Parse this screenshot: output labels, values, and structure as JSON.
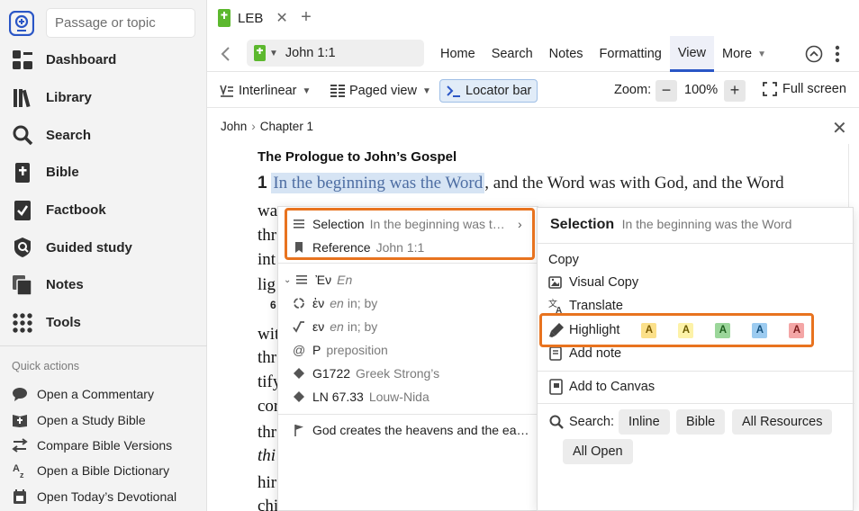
{
  "sidebar": {
    "search_placeholder": "Passage or topic",
    "nav": [
      {
        "label": "Dashboard",
        "icon": "dashboard-icon"
      },
      {
        "label": "Library",
        "icon": "library-icon"
      },
      {
        "label": "Search",
        "icon": "search-icon"
      },
      {
        "label": "Bible",
        "icon": "bible-icon"
      },
      {
        "label": "Factbook",
        "icon": "factbook-icon"
      },
      {
        "label": "Guided study",
        "icon": "guided-study-icon"
      },
      {
        "label": "Notes",
        "icon": "notes-icon"
      },
      {
        "label": "Tools",
        "icon": "tools-icon"
      }
    ],
    "quick_actions_title": "Quick actions",
    "quick_actions": [
      {
        "label": "Open a Commentary",
        "icon": "commentary-icon"
      },
      {
        "label": "Open a Study Bible",
        "icon": "study-bible-icon"
      },
      {
        "label": "Compare Bible Versions",
        "icon": "compare-icon"
      },
      {
        "label": "Open a Bible Dictionary",
        "icon": "dictionary-icon"
      },
      {
        "label": "Open Today’s Devotional",
        "icon": "devotional-icon"
      }
    ]
  },
  "tab": {
    "label": "LEB",
    "close": "✕",
    "new": "+"
  },
  "toolbar": {
    "reference": "John 1:1",
    "menu": [
      "Home",
      "Search",
      "Notes",
      "Formatting",
      "View",
      "More"
    ],
    "active_menu": "View"
  },
  "viewbar": {
    "interlinear": "Interlinear",
    "paged_view": "Paged view",
    "locator_bar": "Locator bar",
    "zoom_label": "Zoom:",
    "zoom_minus": "−",
    "zoom_value": "100%",
    "zoom_plus": "+",
    "full_screen": "Full screen"
  },
  "breadcrumb": {
    "book": "John",
    "sep": "›",
    "chapter": "Chapter 1",
    "close": "✕"
  },
  "reader": {
    "heading": "The Prologue to John’s Gospel",
    "verse_num": "1",
    "highlighted": "In the beginning was the Word",
    "rest": ", and the Word was with God, and the Word",
    "frag_wa": "wa",
    "frag_thr": "thr",
    "frag_int": "int",
    "frag_lig": "lig",
    "frag_6": "6",
    "frag_wit": "wit",
    "frag_thr2": "thr",
    "frag_tify": "tify",
    "frag_cor": "cor",
    "frag_thr3": "thr",
    "frag_thi": "thi",
    "frag_hir": "hir",
    "frag_chi": "chi"
  },
  "context_menu": {
    "selection_label": "Selection",
    "selection_value": "In the beginning was t…",
    "reference_label": "Reference",
    "reference_value": "John 1:1",
    "greek_word": "Ἐν",
    "greek_translit": "En",
    "lemma": "ἐν",
    "lemma_gloss_translit": "en",
    "lemma_gloss": "in; by",
    "root": "εν",
    "root_translit": "en",
    "root_gloss": "in; by",
    "morph": "P",
    "morph_desc": "preposition",
    "strongs": "G1722",
    "strongs_desc": "Greek Strong’s",
    "ln": "LN 67.33",
    "ln_desc": "Louw-Nida",
    "topic": "God creates the heavens and the ea…"
  },
  "panel": {
    "title": "Selection",
    "subtitle": "In the beginning was the Word",
    "copy": "Copy",
    "visual_copy": "Visual Copy",
    "translate": "Translate",
    "highlight": "Highlight",
    "swatch_letter": "A",
    "swatch_colors": [
      "#f6d55c",
      "#f8e27a",
      "#4caf50",
      "#4aa3df",
      "#e57373"
    ],
    "add_note": "Add note",
    "add_to_canvas": "Add to Canvas",
    "search_label": "Search:",
    "search_options": [
      "Inline",
      "Bible",
      "All Resources",
      "All Open"
    ]
  },
  "colors": {
    "accent": "#2a56c6",
    "highlight_box": "#e8731f",
    "selection_bg": "#d6e4f4"
  }
}
